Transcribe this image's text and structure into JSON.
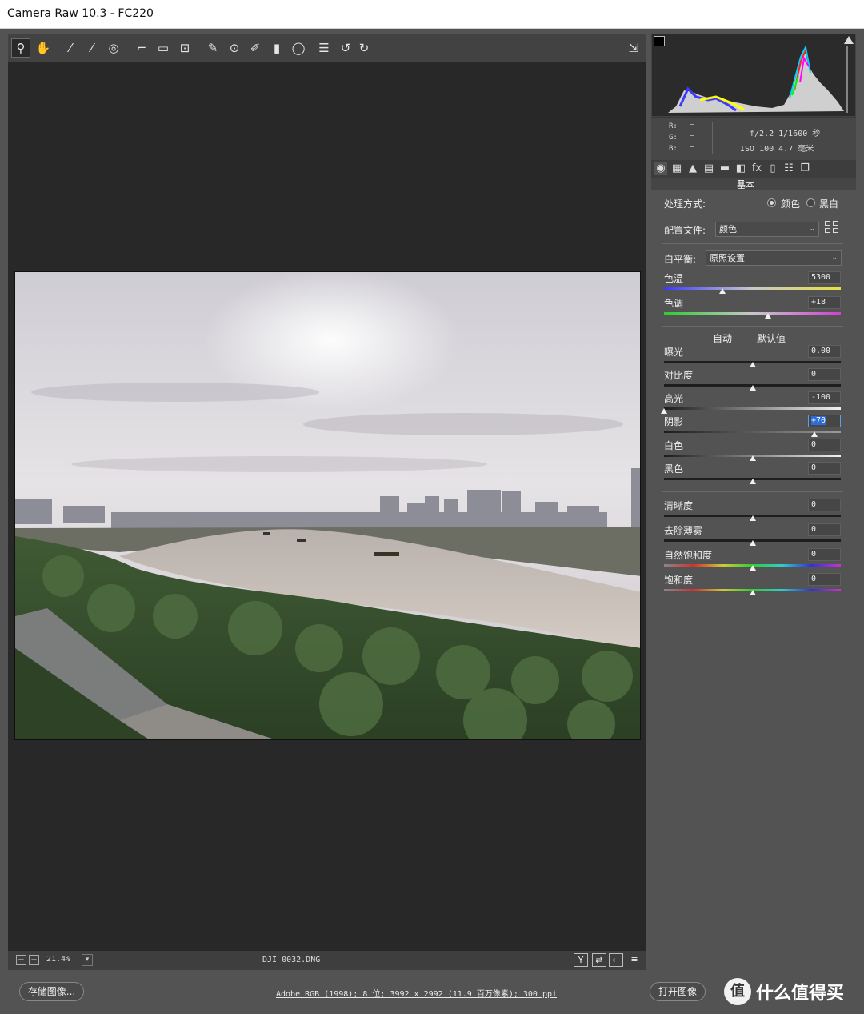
{
  "window": {
    "title": "Camera Raw 10.3 -  FC220"
  },
  "toolbar": {
    "tools": [
      {
        "name": "zoom-tool-icon",
        "glyph": "⚲",
        "active": true
      },
      {
        "name": "hand-tool-icon",
        "glyph": "✋"
      },
      {
        "name": "white-balance-tool-icon",
        "glyph": "⁄"
      },
      {
        "name": "color-sampler-tool-icon",
        "glyph": "⁄"
      },
      {
        "name": "targeted-adjustment-tool-icon",
        "glyph": "◎"
      },
      {
        "name": "crop-tool-icon",
        "glyph": "⌐"
      },
      {
        "name": "straighten-tool-icon",
        "glyph": "▭"
      },
      {
        "name": "transform-tool-icon",
        "glyph": "⊡"
      },
      {
        "name": "spot-removal-tool-icon",
        "glyph": "✎"
      },
      {
        "name": "red-eye-tool-icon",
        "glyph": "⊙"
      },
      {
        "name": "adjustment-brush-icon",
        "glyph": "✐"
      },
      {
        "name": "graduated-filter-icon",
        "glyph": "▮"
      },
      {
        "name": "radial-filter-icon",
        "glyph": "◯"
      },
      {
        "name": "preferences-icon",
        "glyph": "☰"
      },
      {
        "name": "rotate-left-icon",
        "glyph": "↺"
      },
      {
        "name": "rotate-right-icon",
        "glyph": "↻"
      }
    ],
    "fullscreen_icon": "⇲"
  },
  "status": {
    "zoom_out": "−",
    "zoom_in": "+",
    "zoom": "21.4%",
    "filename": "DJI_0032.DNG",
    "icons": [
      "Y",
      "⇄",
      "⇠",
      "≡"
    ]
  },
  "footer": {
    "save_label": "存储图像...",
    "info_link": "Adobe RGB (1998); 8 位; 3992 x 2992 (11.9 百万像素); 300 ppi",
    "open_label": "打开图像",
    "watermark_circle": "值",
    "watermark_text": "什么值得买"
  },
  "info": {
    "r": "R:",
    "g": "G:",
    "b": "B:",
    "dash": "—",
    "aperture_shutter": "f/2.2  1/1600 秒",
    "iso_focal": "ISO 100  4.7 毫米"
  },
  "panel": {
    "tab_icons": [
      "◉",
      "▦",
      "▲",
      "▤",
      "▬",
      "◧",
      "fx",
      "▯",
      "☷",
      "❐"
    ],
    "section": "基本",
    "treatment_label": "处理方式:",
    "treatment_color": "颜色",
    "treatment_bw": "黑白",
    "profile_label": "配置文件:",
    "profile_value": "颜色",
    "wb_label": "白平衡:",
    "wb_value": "原照设置",
    "auto_label": "自动",
    "default_label": "默认值",
    "sliders": [
      {
        "id": "temp",
        "label": "色温",
        "value": "5300",
        "pos": 0.33
      },
      {
        "id": "tint",
        "label": "色调",
        "value": "+18",
        "pos": 0.59
      },
      {
        "id": "exposure",
        "label": "曝光",
        "value": "0.00",
        "pos": 0.5
      },
      {
        "id": "contrast",
        "label": "对比度",
        "value": "0",
        "pos": 0.5
      },
      {
        "id": "highlights",
        "label": "高光",
        "value": "-100",
        "pos": 0.0
      },
      {
        "id": "shadows",
        "label": "阴影",
        "value": "+70",
        "pos": 0.85
      },
      {
        "id": "whites",
        "label": "白色",
        "value": "0",
        "pos": 0.5
      },
      {
        "id": "blacks",
        "label": "黑色",
        "value": "0",
        "pos": 0.5
      },
      {
        "id": "clarity",
        "label": "清晰度",
        "value": "0",
        "pos": 0.5
      },
      {
        "id": "dehaze",
        "label": "去除薄雾",
        "value": "0",
        "pos": 0.5
      },
      {
        "id": "vibrance",
        "label": "自然饱和度",
        "value": "0",
        "pos": 0.5
      },
      {
        "id": "saturation",
        "label": "饱和度",
        "value": "0",
        "pos": 0.5
      }
    ]
  },
  "colors": {
    "accent": "#2d6bd6",
    "panel": "#535353",
    "canvas": "#282828"
  }
}
